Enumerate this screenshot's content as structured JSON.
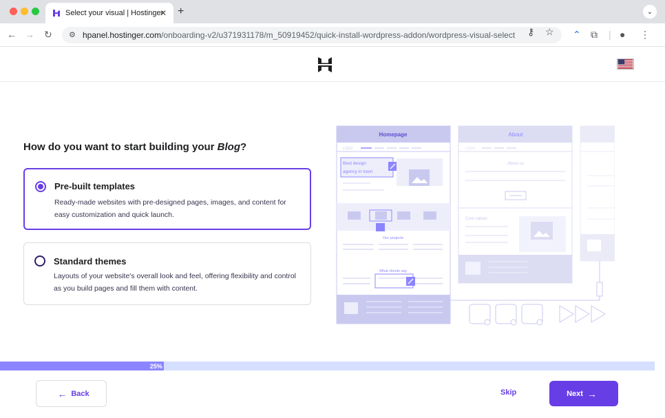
{
  "browser": {
    "tab_title": "Select your visual | Hostinger",
    "tab_close": "✕",
    "new_tab": "+",
    "url_host": "hpanel.hostinger.com",
    "url_path": "/onboarding-v2/u371931178/m_50919452/quick-install-wordpress-addon/wordpress-visual-select",
    "icons": [
      "back-arrow-icon",
      "forward-arrow-icon",
      "reload-icon",
      "site-settings-icon",
      "password-key-icon",
      "star-icon",
      "extension-icon",
      "puzzle-icon",
      "profile-icon",
      "menu-icon"
    ]
  },
  "header": {
    "logo": "hostinger-logo",
    "language_flag": "us-flag"
  },
  "main": {
    "question_prefix": "How do you want to start building your ",
    "question_emphasis": "Blog",
    "question_suffix": "?",
    "options": [
      {
        "title": "Pre-built templates",
        "description": "Ready-made websites with pre-designed pages, images, and content for easy customization and quick launch.",
        "selected": true
      },
      {
        "title": "Standard themes",
        "description": "Layouts of your website's overall look and feel, offering flexibility and control as you build pages and fill them with content.",
        "selected": false
      }
    ],
    "illustration": {
      "page1_title": "Homepage",
      "page2_title": "About",
      "logo_text": "LOGO",
      "headline_line1": "Best design",
      "headline_line2": "agency in town",
      "section1": "Our projects",
      "section2": "What clients say",
      "about_heading": "About us",
      "core_values": "Core values"
    }
  },
  "progress": {
    "percent": 25,
    "label": "25%"
  },
  "footer": {
    "back_label": "Back",
    "skip_label": "Skip",
    "next_label": "Next"
  },
  "colors": {
    "accent": "#673de6",
    "progress_track": "#d5dfff",
    "progress_fill": "#8c85ff",
    "illustration": "#c9c9f0"
  }
}
